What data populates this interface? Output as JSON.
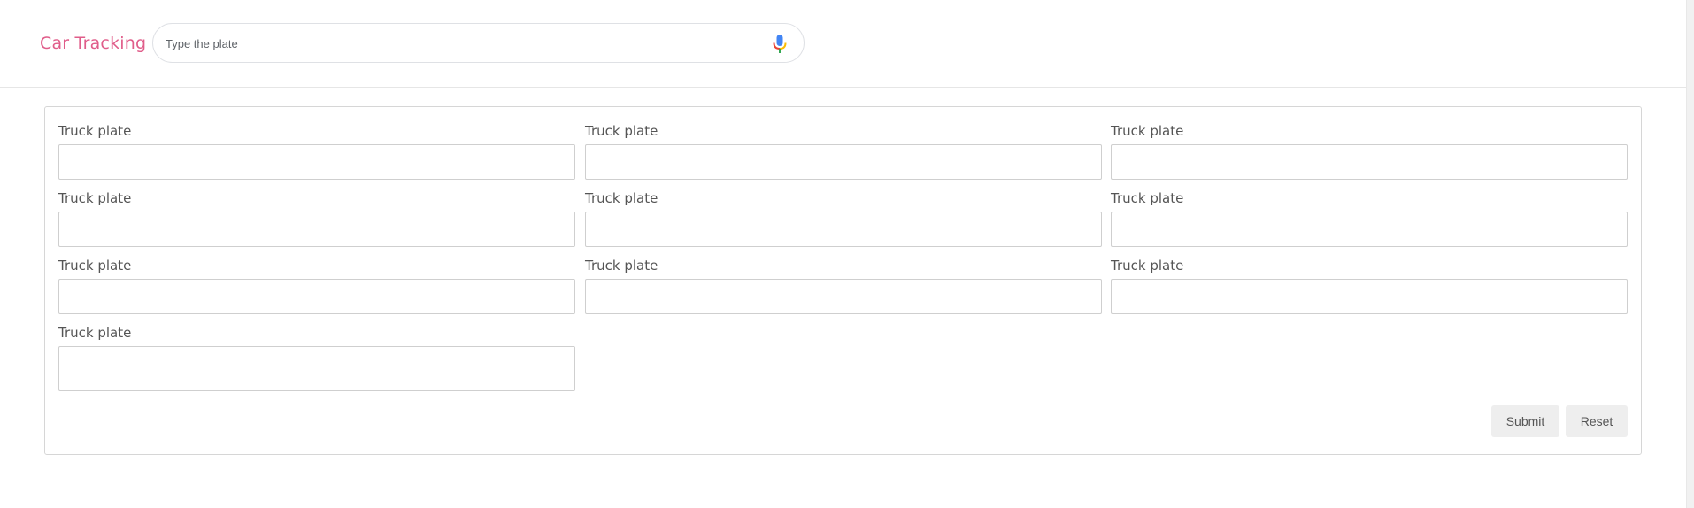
{
  "header": {
    "brand": "Car Tracking",
    "search": {
      "placeholder": "Type the plate",
      "value": ""
    }
  },
  "form": {
    "fields": [
      {
        "label": "Truck plate",
        "value": ""
      },
      {
        "label": "Truck plate",
        "value": ""
      },
      {
        "label": "Truck plate",
        "value": ""
      },
      {
        "label": "Truck plate",
        "value": ""
      },
      {
        "label": "Truck plate",
        "value": ""
      },
      {
        "label": "Truck plate",
        "value": ""
      },
      {
        "label": "Truck plate",
        "value": ""
      },
      {
        "label": "Truck plate",
        "value": ""
      },
      {
        "label": "Truck plate",
        "value": ""
      },
      {
        "label": "Truck plate",
        "value": ""
      }
    ],
    "submit_label": "Submit",
    "reset_label": "Reset"
  },
  "colors": {
    "brand": "#e05d8a",
    "mic_blue": "#4285f4",
    "mic_red": "#ea4335",
    "mic_yellow": "#fbbc05",
    "mic_green": "#34a853"
  },
  "icons": {
    "search_voice": "microphone-icon"
  }
}
